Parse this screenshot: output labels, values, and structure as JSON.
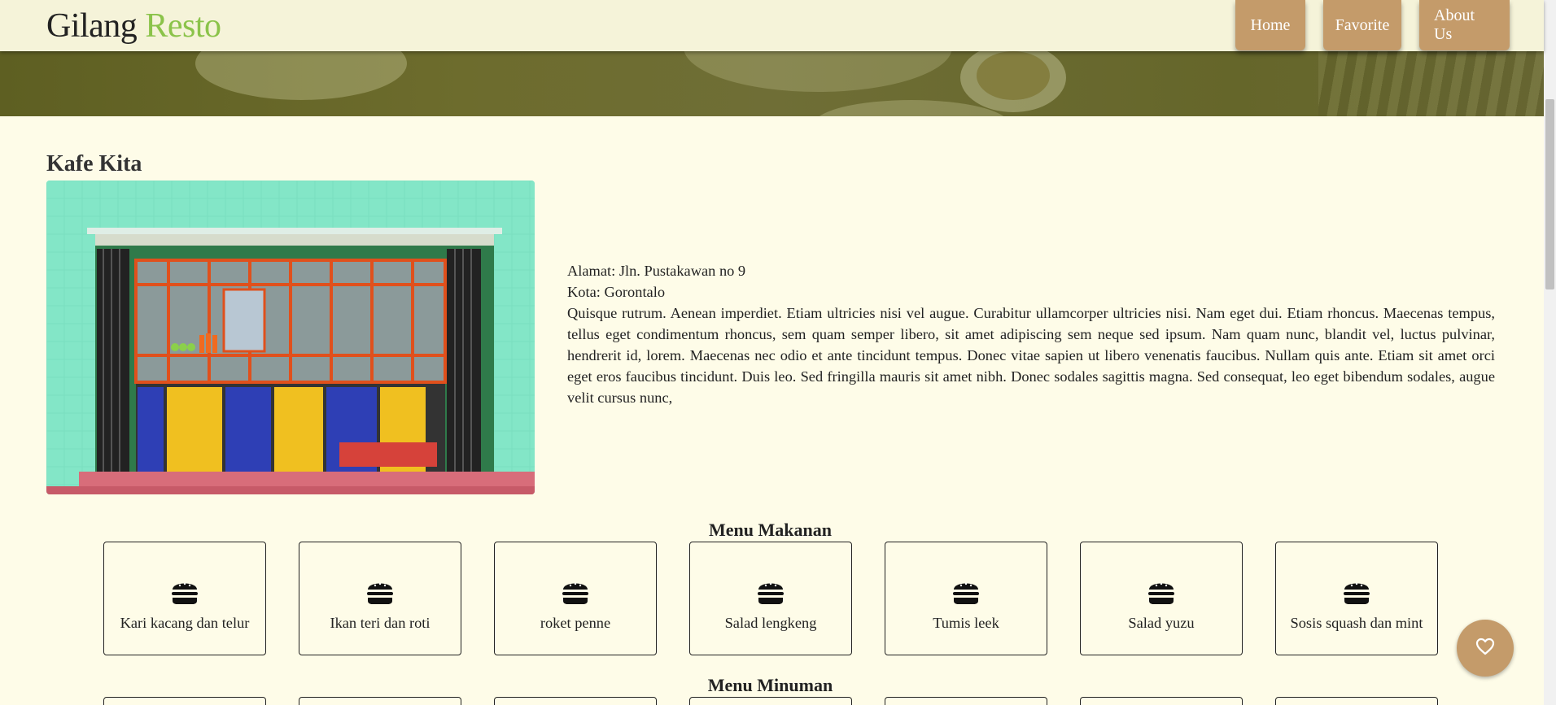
{
  "header": {
    "brand_main": "Gilang",
    "brand_accent": "Resto",
    "nav": [
      {
        "label": "Home"
      },
      {
        "label": "Favorite"
      },
      {
        "label": "About Us"
      }
    ]
  },
  "restaurant": {
    "name": "Kafe Kita",
    "address": "Alamat: Jln. Pustakawan no 9",
    "city": "Kota: Gorontalo",
    "description": "Quisque rutrum. Aenean imperdiet. Etiam ultricies nisi vel augue. Curabitur ullamcorper ultricies nisi. Nam eget dui. Etiam rhoncus. Maecenas tempus, tellus eget condimentum rhoncus, sem quam semper libero, sit amet adipiscing sem neque sed ipsum. Nam quam nunc, blandit vel, luctus pulvinar, hendrerit id, lorem. Maecenas nec odio et ante tincidunt tempus. Donec vitae sapien ut libero venenatis faucibus. Nullam quis ante. Etiam sit amet orci eget eros faucibus tincidunt. Duis leo. Sed fringilla mauris sit amet nibh. Donec sodales sagittis magna. Sed consequat, leo eget bibendum sodales, augue velit cursus nunc,"
  },
  "menu_food": {
    "title": "Menu Makanan",
    "icon": "burger-icon",
    "items": [
      {
        "name": "Kari kacang dan telur"
      },
      {
        "name": "Ikan teri dan roti"
      },
      {
        "name": "roket penne"
      },
      {
        "name": "Salad lengkeng"
      },
      {
        "name": "Tumis leek"
      },
      {
        "name": "Salad yuzu"
      },
      {
        "name": "Sosis squash dan mint"
      }
    ]
  },
  "menu_drink": {
    "title": "Menu Minuman"
  },
  "fab": {
    "icon": "heart-icon"
  },
  "colors": {
    "background": "#fefce8",
    "header": "#f5f3d9",
    "accent_brand": "#8bc34a",
    "button": "#c49b6a"
  }
}
